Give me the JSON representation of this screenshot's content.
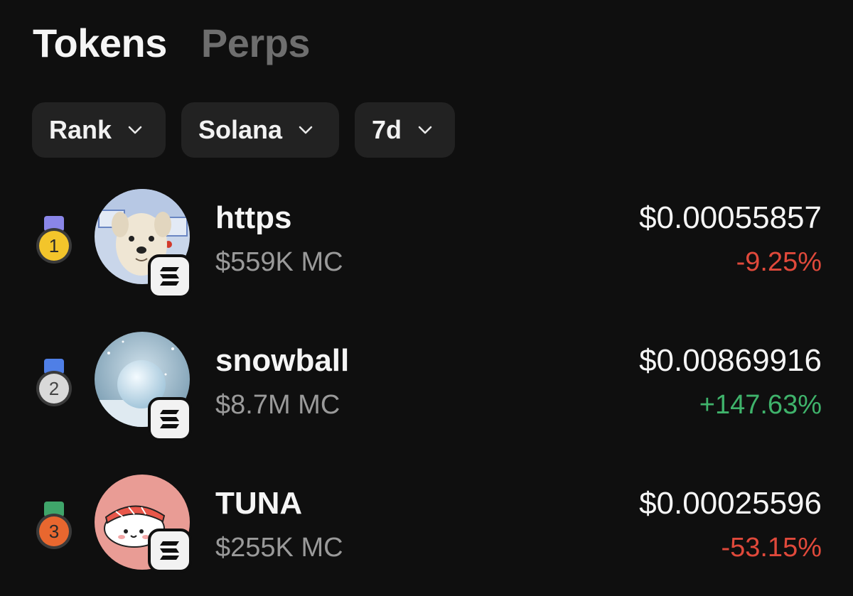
{
  "tabs": [
    {
      "label": "Tokens",
      "active": true
    },
    {
      "label": "Perps",
      "active": false
    }
  ],
  "filters": [
    {
      "label": "Rank",
      "icon": "chevron-down-icon"
    },
    {
      "label": "Solana",
      "icon": "chevron-down-icon"
    },
    {
      "label": "7d",
      "icon": "chevron-down-icon"
    }
  ],
  "tokens": [
    {
      "rank": "1",
      "medal": "gold",
      "name": "https",
      "market_cap": "$559K MC",
      "price": "$0.00055857",
      "change": "-9.25%",
      "change_direction": "down",
      "chain_icon": "solana-icon",
      "avatar_icon": "dog-avatar-icon"
    },
    {
      "rank": "2",
      "medal": "silver",
      "name": "snowball",
      "market_cap": "$8.7M MC",
      "price": "$0.00869916",
      "change": "+147.63%",
      "change_direction": "up",
      "chain_icon": "solana-icon",
      "avatar_icon": "snowball-avatar-icon"
    },
    {
      "rank": "3",
      "medal": "bronze",
      "name": "TUNA",
      "market_cap": "$255K MC",
      "price": "$0.00025596",
      "change": "-53.15%",
      "change_direction": "down",
      "chain_icon": "solana-icon",
      "avatar_icon": "sushi-avatar-icon"
    }
  ],
  "colors": {
    "background": "#0f0f0f",
    "negative": "#e0493b",
    "positive": "#3fb36b",
    "muted": "#9a9a9a",
    "chip": "#222222"
  }
}
